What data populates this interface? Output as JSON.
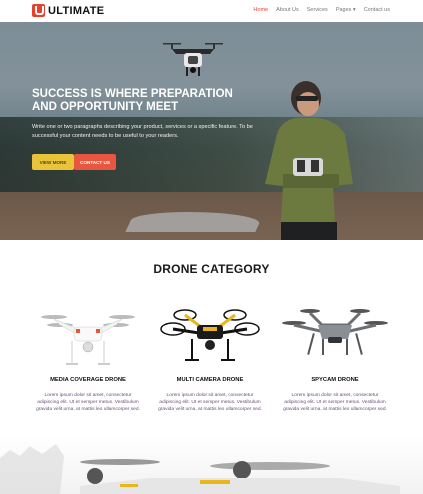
{
  "brand": {
    "name": "ULTIMATE",
    "accent": "#e8402f"
  },
  "nav": {
    "items": [
      {
        "label": "Home",
        "active": true
      },
      {
        "label": "About Us"
      },
      {
        "label": "Services"
      },
      {
        "label": "Pages ▾"
      },
      {
        "label": "Contact us"
      }
    ]
  },
  "hero": {
    "title": "SUCCESS IS WHERE PREPARATION AND OPPORTUNITY MEET",
    "text": "Write one or two paragraphs describing your product, services or a specific feature. To be successful your content needs to be useful to your readers.",
    "primary_button": "VIEW MORE",
    "secondary_button": "CONTACT US"
  },
  "category": {
    "title": "DRONE CATEGORY",
    "cards": [
      {
        "title": "MEDIA COVERAGE DRONE",
        "text": "Lorem ipsum dolor sit amet, consectetur adipiscing elit. Ut et semper metus. Vestibulum gravida velit urna, at mattis leo ullamcorper sed."
      },
      {
        "title": "MULTI CAMERA DRONE",
        "text": "Lorem ipsum dolor sit amet, consectetur adipiscing elit. Ut et semper metus. Vestibulum gravida velit urna, at mattis leo ullamcorper sed."
      },
      {
        "title": "SPYCAM DRONE",
        "text": "Lorem ipsum dolor sit amet, consectetur adipiscing elit. Ut et semper metus. Vestibulum gravida velit urna, at mattis leo ullamcorper sed."
      }
    ]
  },
  "colors": {
    "yellow": "#e9c33a",
    "red": "#e8563f"
  }
}
